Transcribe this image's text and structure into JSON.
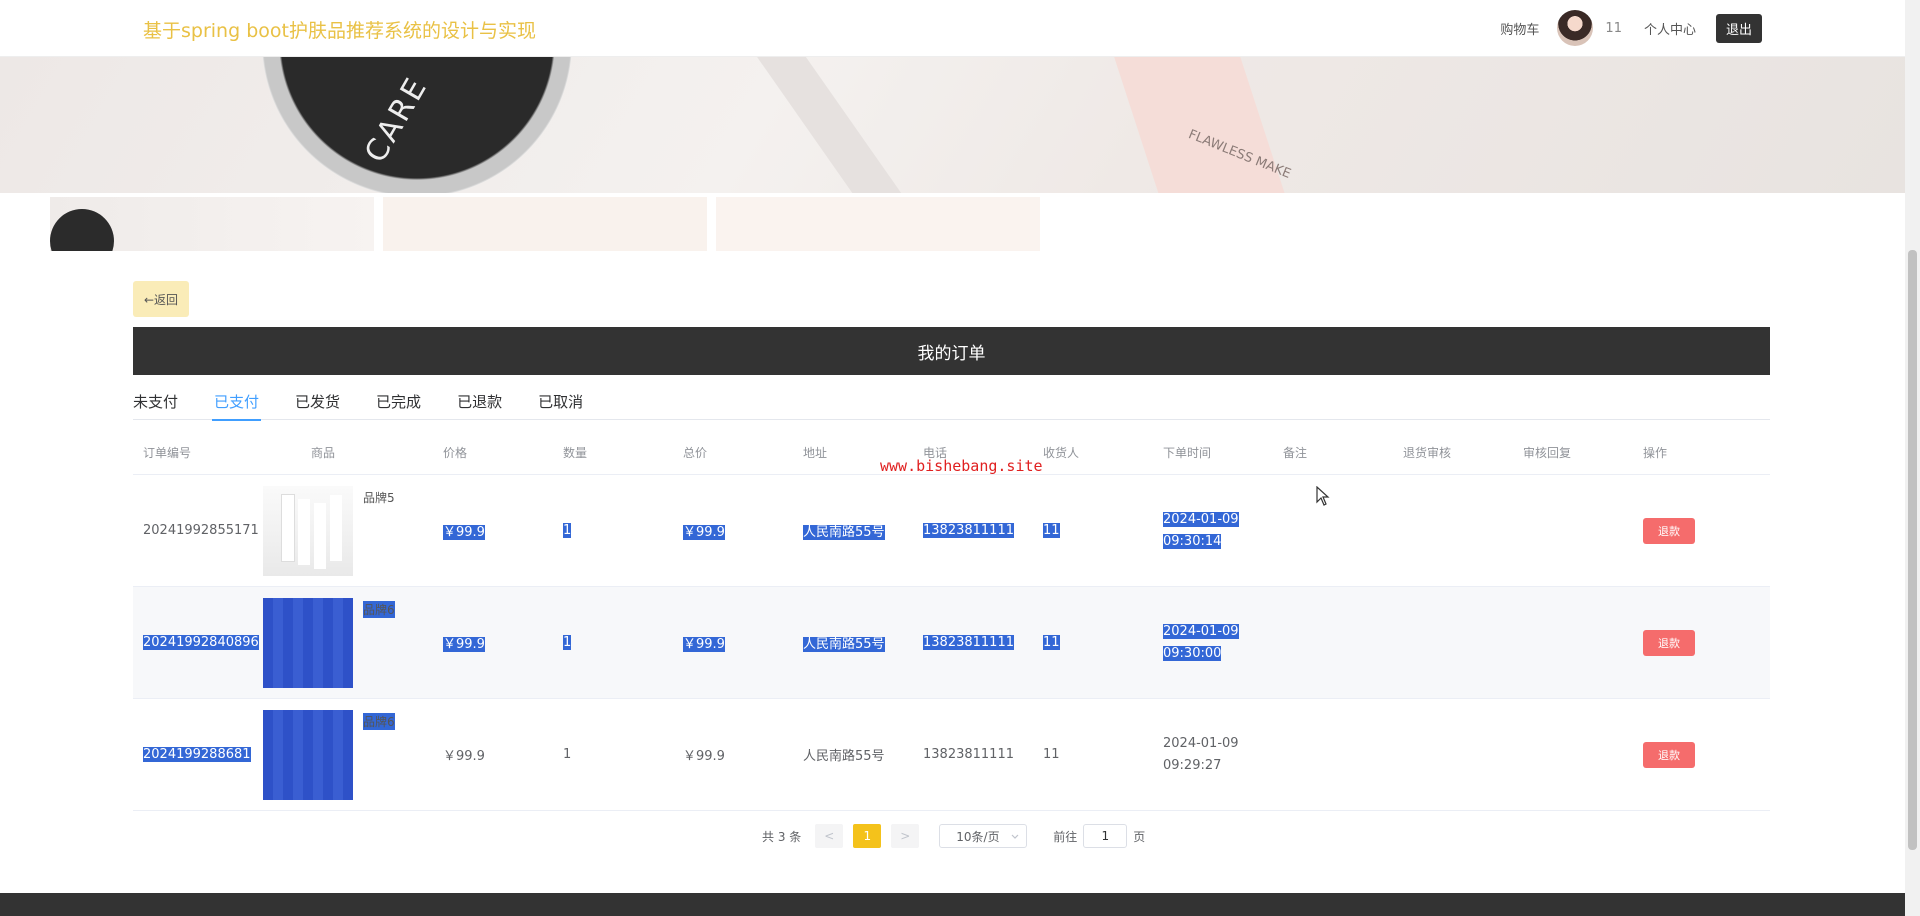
{
  "header": {
    "site_title": "基于spring boot护肤品推荐系统的设计与实现",
    "cart": "购物车",
    "username": "11",
    "profile": "个人中心",
    "logout": "退出"
  },
  "banner": {
    "compact_text": "CARE",
    "tube_text": "FLAWLESS MAKE"
  },
  "back_label": "←返回",
  "page_title": "我的订单",
  "tabs": [
    "未支付",
    "已支付",
    "已发货",
    "已完成",
    "已退款",
    "已取消"
  ],
  "active_tab": 1,
  "table": {
    "headers": [
      "订单编号",
      "商品",
      "价格",
      "数量",
      "总价",
      "地址",
      "电话",
      "收货人",
      "下单时间",
      "备注",
      "退货审核",
      "审核回复",
      "操作"
    ],
    "rows": [
      {
        "id": "20241992855171",
        "goods": "品牌5",
        "price": "￥99.9",
        "qty": "1",
        "total": "￥99.9",
        "address": "人民南路55号",
        "phone": "13823811111",
        "receiver": "11",
        "time": "2024-01-09 09:30:14",
        "action": "退款"
      },
      {
        "id": "20241992840896",
        "goods": "品牌6",
        "price": "￥99.9",
        "qty": "1",
        "total": "￥99.9",
        "address": "人民南路55号",
        "phone": "13823811111",
        "receiver": "11",
        "time": "2024-01-09 09:30:00",
        "action": "退款"
      },
      {
        "id": "2024199288681",
        "goods": "品牌6",
        "price": "￥99.9",
        "qty": "1",
        "total": "￥99.9",
        "address": "人民南路55号",
        "phone": "13823811111",
        "receiver": "11",
        "time": "2024-01-09 09:29:27",
        "action": "退款"
      }
    ]
  },
  "pagination": {
    "total": "共 3 条",
    "prev": "<",
    "current": "1",
    "next": ">",
    "page_size": "10条/页",
    "goto_label": "前往",
    "goto_value": "1",
    "page_unit": "页"
  },
  "watermark": "www.bishebang.site",
  "colors": {
    "accent": "#409eff",
    "title": "#e9c145",
    "danger": "#f56c6c",
    "dark": "#333333",
    "pager_active": "#f4c21b"
  }
}
